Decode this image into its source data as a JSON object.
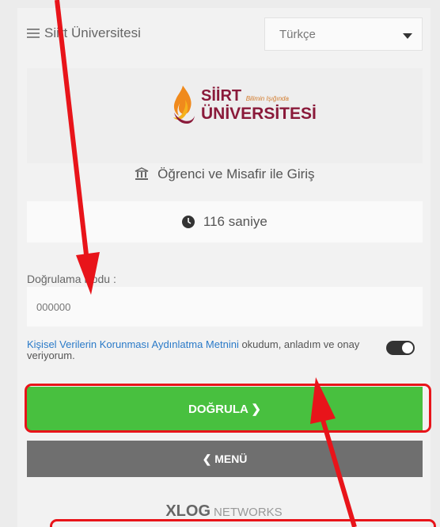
{
  "header": {
    "site_title": "Siirt Üniversitesi",
    "language": "Türkçe"
  },
  "logo": {
    "line1": "SİİRT",
    "tagline": "Bilimin Işığında",
    "line2": "ÜNİVERSİTESİ"
  },
  "login": {
    "title": "Öğrenci ve Misafir ile Giriş"
  },
  "timer": {
    "text": "116 saniye"
  },
  "form": {
    "code_label": "Doğrulama Kodu :",
    "code_placeholder": "000000",
    "consent_link": "Kişisel Verilerin Korunması Aydınlatma Metnini",
    "consent_text": " okudum, anladım ve onay veriyorum.",
    "consent_checked": true
  },
  "buttons": {
    "verify": "DOĞRULA ❯",
    "menu": "❮ MENÜ"
  },
  "footer": {
    "brand_bold": "XLOG",
    "brand_light": "NETWORKS"
  },
  "colors": {
    "verify": "#48c03f",
    "menu": "#6f6f6f",
    "annotation": "#e8141a"
  }
}
